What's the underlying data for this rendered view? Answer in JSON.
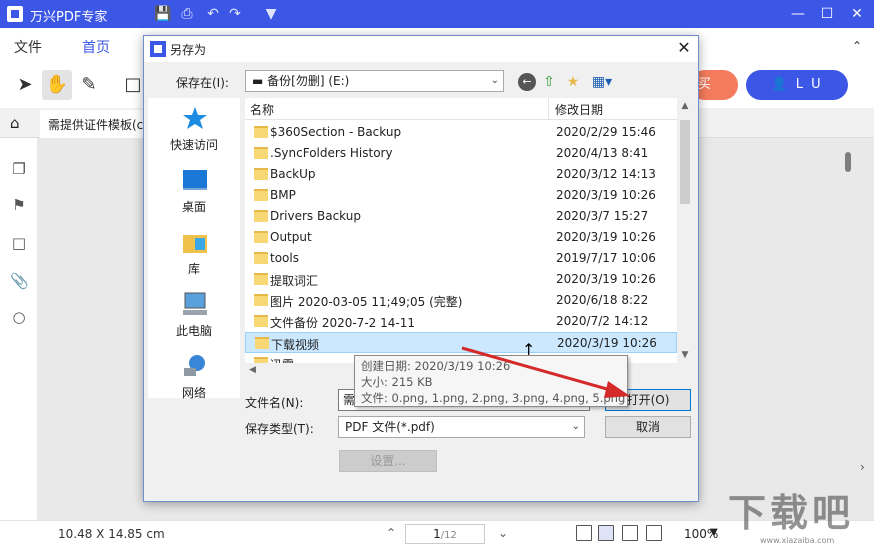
{
  "app": {
    "title": "万兴PDF专家",
    "menus": [
      "文件",
      "首页"
    ],
    "active_menu": "首页",
    "buy_label": "买",
    "user_label": "L U",
    "doc_tab": "需提供证件模板(c",
    "status": {
      "dimensions": "10.48 X 14.85 cm",
      "current_page": "1",
      "total_pages": "/12",
      "zoom": "100%"
    },
    "watermark": "下载吧",
    "watermark_url": "www.xiazaiba.com"
  },
  "dialog": {
    "title": "另存为",
    "save_in_label": "保存在(I):",
    "save_in_value": "备份[勿删] (E:)",
    "places": [
      "快速访问",
      "桌面",
      "库",
      "此电脑",
      "网络"
    ],
    "columns": {
      "name": "名称",
      "date": "修改日期"
    },
    "files": [
      {
        "name": "$360Section - Backup",
        "date": "2020/2/29 15:46"
      },
      {
        "name": ".SyncFolders History",
        "date": "2020/4/13 8:41"
      },
      {
        "name": "BackUp",
        "date": "2020/3/12 14:13"
      },
      {
        "name": "BMP",
        "date": "2020/3/19 10:26"
      },
      {
        "name": "Drivers Backup",
        "date": "2020/3/7 15:27"
      },
      {
        "name": "Output",
        "date": "2020/3/19 10:26"
      },
      {
        "name": "tools",
        "date": "2019/7/17 10:06"
      },
      {
        "name": "提取词汇",
        "date": "2020/3/19 10:26"
      },
      {
        "name": "图片 2020-03-05 11;49;05 (完整)",
        "date": "2020/6/18 8:22"
      },
      {
        "name": "文件备份 2020-7-2 14-11",
        "date": "2020/7/2 14:12"
      },
      {
        "name": "下载视频",
        "date": "2020/3/19 10:26"
      },
      {
        "name": "迅雷 ... ",
        "date": ""
      }
    ],
    "selected_index": 10,
    "tooltip": {
      "created": "创建日期: 2020/3/19 10:26",
      "size": "大小: 215 KB",
      "files": "文件: 0.png, 1.png, 2.png, 3.png, 4.png, 5.png"
    },
    "filename_label": "文件名(N):",
    "filename_value": "需",
    "filetype_label": "保存类型(T):",
    "filetype_value": "PDF 文件(*.pdf)",
    "open_button": "打开(O)",
    "cancel_button": "取消",
    "settings_button": "设置..."
  },
  "colors": {
    "brand": "#3c56e6",
    "buy": "#f47b5e",
    "selection": "#cce8ff",
    "arrow": "#d42a2a"
  }
}
